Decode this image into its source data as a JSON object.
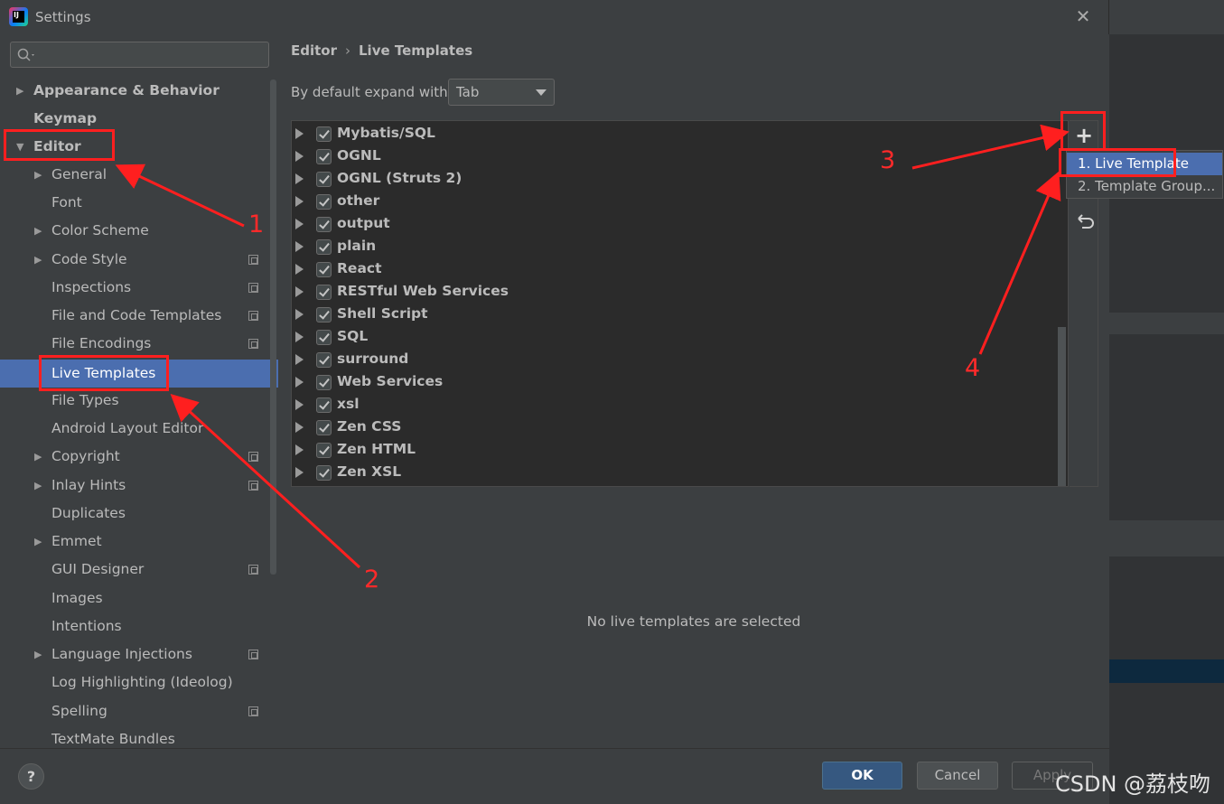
{
  "window": {
    "title": "Settings"
  },
  "sidebar": {
    "items": [
      {
        "label": "Appearance & Behavior"
      },
      {
        "label": "Keymap"
      },
      {
        "label": "Editor"
      },
      {
        "label": "General"
      },
      {
        "label": "Font"
      },
      {
        "label": "Color Scheme"
      },
      {
        "label": "Code Style"
      },
      {
        "label": "Inspections"
      },
      {
        "label": "File and Code Templates"
      },
      {
        "label": "File Encodings"
      },
      {
        "label": "Live Templates",
        "selected": true
      },
      {
        "label": "File Types"
      },
      {
        "label": "Android Layout Editor"
      },
      {
        "label": "Copyright"
      },
      {
        "label": "Inlay Hints"
      },
      {
        "label": "Duplicates"
      },
      {
        "label": "Emmet"
      },
      {
        "label": "GUI Designer"
      },
      {
        "label": "Images"
      },
      {
        "label": "Intentions"
      },
      {
        "label": "Language Injections"
      },
      {
        "label": "Log Highlighting (Ideolog)"
      },
      {
        "label": "Spelling"
      },
      {
        "label": "TextMate Bundles"
      }
    ]
  },
  "breadcrumb": {
    "parent": "Editor",
    "separator": "›",
    "current": "Live Templates"
  },
  "expand": {
    "label": "By default expand with",
    "value": "Tab"
  },
  "template_groups": [
    {
      "name": "Mybatis/SQL",
      "checked": true
    },
    {
      "name": "OGNL",
      "checked": true
    },
    {
      "name": "OGNL (Struts 2)",
      "checked": true
    },
    {
      "name": "other",
      "checked": true
    },
    {
      "name": "output",
      "checked": true
    },
    {
      "name": "plain",
      "checked": true
    },
    {
      "name": "React",
      "checked": true
    },
    {
      "name": "RESTful Web Services",
      "checked": true
    },
    {
      "name": "Shell Script",
      "checked": true
    },
    {
      "name": "SQL",
      "checked": true
    },
    {
      "name": "surround",
      "checked": true
    },
    {
      "name": "Web Services",
      "checked": true
    },
    {
      "name": "xsl",
      "checked": true
    },
    {
      "name": "Zen CSS",
      "checked": true
    },
    {
      "name": "Zen HTML",
      "checked": true
    },
    {
      "name": "Zen XSL",
      "checked": true
    }
  ],
  "toolbar": {
    "add_label": "+"
  },
  "popup": {
    "items": [
      {
        "label": "1. Live Template"
      },
      {
        "label": "2. Template Group..."
      }
    ]
  },
  "empty_message": "No live templates are selected",
  "footer": {
    "help": "?",
    "ok": "OK",
    "cancel": "Cancel",
    "apply": "Apply"
  },
  "annotations": {
    "n1": "1",
    "n2": "2",
    "n3": "3",
    "n4": "4"
  },
  "watermark": "CSDN @荔枝吻",
  "colors": {
    "selection": "#4b6eaf",
    "annotation": "#ff1f1f",
    "ok_button": "#365880"
  }
}
